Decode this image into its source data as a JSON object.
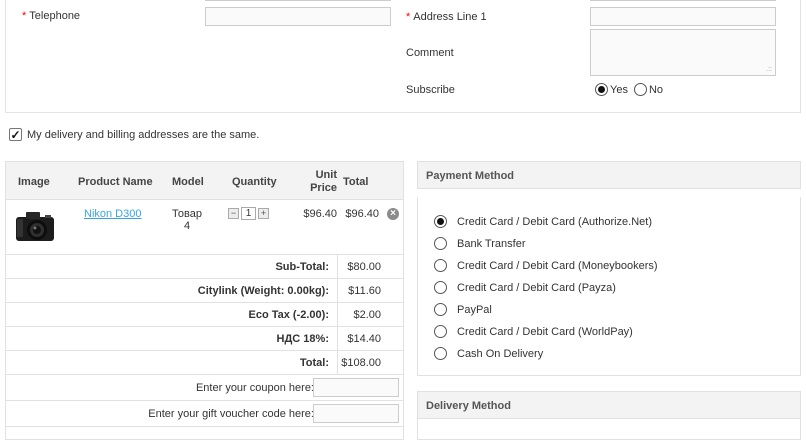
{
  "form": {
    "telephone_label": "Telephone",
    "telephone_value": "",
    "address1_label": "Address Line 1",
    "address1_value": "",
    "comment_label": "Comment",
    "comment_value": "",
    "subscribe_label": "Subscribe",
    "subscribe_yes": "Yes",
    "subscribe_no": "No",
    "subscribe_selected": "Yes",
    "required_mark": "*"
  },
  "same_address": {
    "label": "My delivery and billing addresses are the same.",
    "checked": true
  },
  "cart": {
    "headers": {
      "image": "Image",
      "product_name": "Product Name",
      "model": "Model",
      "quantity": "Quantity",
      "unit_price": "Unit Price",
      "total": "Total"
    },
    "items": [
      {
        "image": "camera-photo",
        "name": "Nikon D300",
        "model": "Товар 4",
        "quantity": "1",
        "unit_price": "$96.40",
        "total": "$96.40"
      }
    ],
    "totals": [
      {
        "label": "Sub-Total:",
        "value": "$80.00"
      },
      {
        "label": "Citylink (Weight: 0.00kg):",
        "value": "$11.60"
      },
      {
        "label": "Eco Tax (-2.00):",
        "value": "$2.00"
      },
      {
        "label": "НДС 18%:",
        "value": "$14.40"
      },
      {
        "label": "Total:",
        "value": "$108.00"
      }
    ],
    "coupon_label": "Enter your coupon here:",
    "coupon_value": "",
    "voucher_label": "Enter your gift voucher code here:",
    "voucher_value": ""
  },
  "payment": {
    "title": "Payment Method",
    "selected": "Credit Card / Debit Card (Authorize.Net)",
    "options": [
      "Credit Card / Debit Card (Authorize.Net)",
      "Bank Transfer",
      "Credit Card / Debit Card (Moneybookers)",
      "Credit Card / Debit Card (Payza)",
      "PayPal",
      "Credit Card / Debit Card (WorldPay)",
      "Cash On Delivery"
    ]
  },
  "delivery": {
    "title": "Delivery Method"
  },
  "colors": {
    "link": "#38a5e0",
    "required": "#ff0000",
    "panel_header_bg": "#f3f3f3",
    "border": "#e1e1e1"
  }
}
